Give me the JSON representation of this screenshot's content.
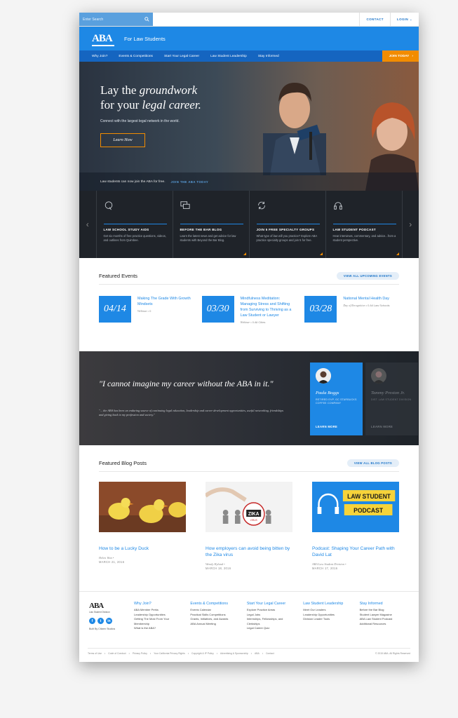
{
  "topbar": {
    "search_placeholder": "Enter Search",
    "contact": "CONTACT",
    "login": "LOGIN ⌄"
  },
  "header": {
    "logo": "ABA",
    "site_title": "For Law Students"
  },
  "nav": {
    "items": [
      {
        "label": "Why Join?"
      },
      {
        "label": "Events & Competitions"
      },
      {
        "label": "Start Your Legal Career"
      },
      {
        "label": "Law Student Leadership"
      },
      {
        "label": "Stay Informed"
      }
    ],
    "join_label": "JOIN TODAY"
  },
  "hero": {
    "title_line1_a": "Lay the ",
    "title_line1_b": "groundwork",
    "title_line2_a": "for your ",
    "title_line2_b": "legal career.",
    "subtitle": "Connect with the largest legal network in the world.",
    "cta": "Learn How",
    "strip_text": "Law students can now join the ABA for free.",
    "strip_link": "JOIN THE ABA TODAY"
  },
  "resources": [
    {
      "icon": "q-icon",
      "title": "LAW SCHOOL STUDY AIDS",
      "desc": "Get six months of free practice questions, videos, and outlines from Quimbee."
    },
    {
      "icon": "chat-icon",
      "title": "BEFORE THE BAR BLOG",
      "desc": "Learn the latest news and get advice for law students with Beyond the Bar Blog."
    },
    {
      "icon": "refresh-icon",
      "title": "JOIN 5 FREE SPECIALTY GROUPS",
      "desc": "What type of law will you practice? Explore ABA practice specialty groups and join 5 for free."
    },
    {
      "icon": "headphones-icon",
      "title": "LAW STUDENT PODCAST",
      "desc": "Hear interviews, commentary, and advice...from a student perspective."
    }
  ],
  "events": {
    "title": "Featured Events",
    "view_all": "VIEW ALL UPCOMING EVENTS",
    "items": [
      {
        "date": "04/14",
        "title": "Making The Grade With Growth Mindsets",
        "type": "Webinar",
        "sep": "•",
        "audience": "0"
      },
      {
        "date": "03/30",
        "title": "Mindfulness Meditation: Managing Stress and Shifting from Surviving to Thriving as a Law Student or Lawyer",
        "type": "Webinar",
        "sep": "•",
        "audience": "0 All Cities"
      },
      {
        "date": "03/28",
        "title": "National Mental Health Day",
        "type": "Day of Recognition",
        "sep": "•",
        "audience": "0 All Law Schools"
      }
    ]
  },
  "testimonial": {
    "quote": "\"I cannot imagine my career without the ABA in it.\"",
    "sub": "\"... the ABA has been an enduring source of continuing legal education, leadership and career development opportunities, useful networking, friendships and giving back to my profession and society.\"",
    "cards": [
      {
        "name": "Paula Boggs",
        "role": "RETIRED EVP, GC STARBUCKS COFFEE COMPANY",
        "more": "LEARN MORE"
      },
      {
        "name": "Tammy Preston Jr.",
        "role": "DIST. LAW STUDENT DIVISION",
        "more": "LEARN MORE"
      }
    ]
  },
  "blog": {
    "title": "Featured Blog Posts",
    "view_all": "VIEW ALL BLOG POSTS",
    "posts": [
      {
        "title": "How to be a Lucky Duck",
        "author": "Helen Wan",
        "sep": "•",
        "date": "MARCH 21, 2016"
      },
      {
        "title": "How employers can avoid being bitten by the Zika virus",
        "author": "Wendy Hyland",
        "sep": "•",
        "date": "MARCH 18, 2016"
      },
      {
        "title": "Podcast: Shaping Your Career Path with David Lat",
        "author": "ABA Law Student Division",
        "sep": "•",
        "date": "MARCH 17, 2016"
      }
    ],
    "podcast_line1": "LAW STUDENT",
    "podcast_line2": "PODCAST",
    "zika_label": "ZIKA",
    "zika_sub": "VIRUS"
  },
  "footer": {
    "logo_mark": "ABA",
    "logo_sub": "Law Student Division",
    "built_by": "Built By Citizen Studios",
    "social": [
      "f",
      "t",
      "in"
    ],
    "columns": [
      {
        "heading": "Why Join?",
        "links": [
          "ABA Member Perks",
          "Leadership Opportunities",
          "Getting The Most From Your",
          "Membership",
          "What is the ABA?"
        ]
      },
      {
        "heading": "Events & Competitions",
        "links": [
          "Events Calendar",
          "Practical Skills Competitions",
          "Grants, Initiatives, and Awards",
          "ABA Annual Meeting"
        ]
      },
      {
        "heading": "Start Your Legal Career",
        "links": [
          "Explore Practice Areas",
          "Legal Jobs",
          "Internships, Fellowships, and",
          "Clerkships",
          "Legal Career Quiz"
        ]
      },
      {
        "heading": "Law Student Leadership",
        "links": [
          "Meet Our Leaders",
          "Leadership Opportunities",
          "Division Leader Tools"
        ]
      },
      {
        "heading": "Stay Informed",
        "links": [
          "Before the Bar Blog",
          "Student Lawyer Magazine",
          "ABA Law Student Podcast",
          "Additional Resources"
        ]
      }
    ],
    "legal_links": [
      "Terms of Use",
      "•",
      "Code of Conduct",
      "•",
      "Privacy Policy",
      "•",
      "Your California Privacy Rights",
      "•",
      "Copyright & IP Policy",
      "•",
      "Advertising & Sponsorship",
      "•",
      "ABA",
      "•",
      "Contact"
    ],
    "copyright": "© 2015 ABA. All Rights Reserved"
  },
  "colors": {
    "brand_blue": "#1e88e5",
    "nav_blue": "#1565c0",
    "accent_orange": "#f28c00",
    "dark": "#1f2329"
  }
}
